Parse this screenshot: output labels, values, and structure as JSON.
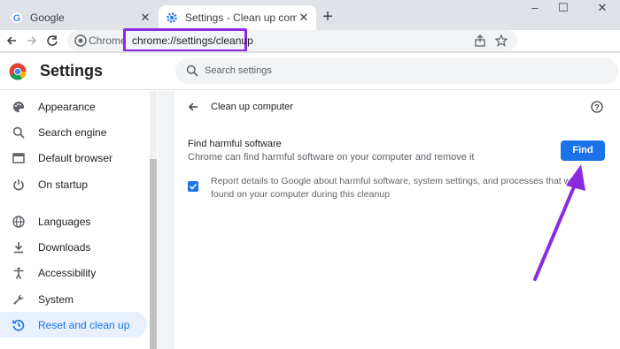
{
  "tabs": [
    {
      "label": "Google",
      "close": "✕"
    },
    {
      "label": "Settings - Clean up computer",
      "close": "✕"
    }
  ],
  "window_controls": {
    "minimize": "–",
    "maximize": "☐",
    "close": "✕"
  },
  "omnibox": {
    "prefix": "Chrome",
    "url": "chrome://settings/cleanup"
  },
  "settings": {
    "title": "Settings",
    "search_placeholder": "Search settings"
  },
  "sidebar": {
    "items": [
      {
        "label": "Appearance",
        "icon": "palette-icon"
      },
      {
        "label": "Search engine",
        "icon": "search-icon"
      },
      {
        "label": "Default browser",
        "icon": "browser-icon"
      },
      {
        "label": "On startup",
        "icon": "power-icon"
      },
      {
        "label": "Languages",
        "icon": "globe-icon"
      },
      {
        "label": "Downloads",
        "icon": "download-icon"
      },
      {
        "label": "Accessibility",
        "icon": "accessibility-icon"
      },
      {
        "label": "System",
        "icon": "wrench-icon"
      },
      {
        "label": "Reset and clean up",
        "icon": "reset-icon",
        "active": true
      }
    ]
  },
  "main": {
    "page_title": "Clean up computer",
    "find_title": "Find harmful software",
    "find_desc": "Chrome can find harmful software on your computer and remove it",
    "find_button": "Find",
    "report_label": "Report details to Google about harmful software, system settings, and processes that were found on your computer during this cleanup",
    "report_checked": true
  },
  "colors": {
    "accent": "#1a73e8",
    "highlight": "#8a2be2"
  }
}
